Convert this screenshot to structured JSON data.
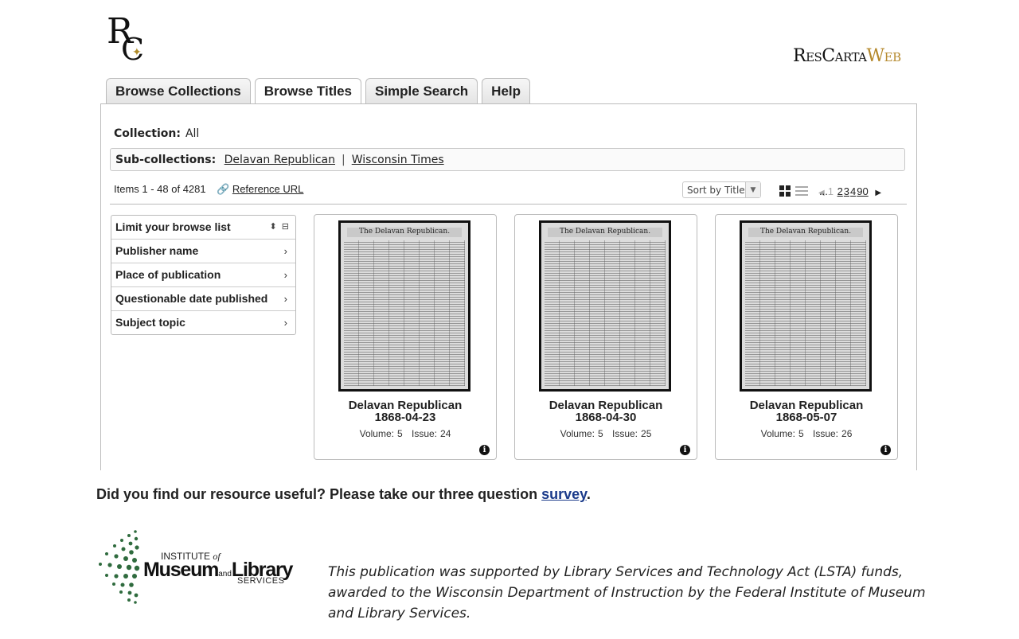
{
  "header": {
    "logo_mark": "RC",
    "brand_part1": "ResCarta",
    "brand_part2": "Web"
  },
  "tabs": [
    {
      "label": "Browse Collections"
    },
    {
      "label": "Browse Titles",
      "active": true
    },
    {
      "label": "Simple Search"
    },
    {
      "label": "Help"
    }
  ],
  "collection": {
    "label": "Collection:",
    "value": "All"
  },
  "subcollections": {
    "label": "Sub-collections:",
    "items": [
      "Delavan Republican",
      "Wisconsin Times"
    ],
    "separator": "|"
  },
  "results": {
    "items_text": "Items 1 - 48 of 4281",
    "reference_url": "Reference URL"
  },
  "sort": {
    "selected": "Sort by Title"
  },
  "pager": {
    "current": "1",
    "pages": [
      "2",
      "3",
      "4"
    ],
    "ellipsis": "...",
    "last": "90"
  },
  "facets": {
    "header": "Limit your browse list",
    "items": [
      "Publisher name",
      "Place of publication",
      "Questionable date published",
      "Subject topic"
    ]
  },
  "cards": [
    {
      "title": "Delavan Republican",
      "date": "1868-04-23",
      "volume_label": "Volume:",
      "volume": "5",
      "issue_label": "Issue:",
      "issue": "24",
      "masthead": "The Delavan Republican."
    },
    {
      "title": "Delavan Republican",
      "date": "1868-04-30",
      "volume_label": "Volume:",
      "volume": "5",
      "issue_label": "Issue:",
      "issue": "25",
      "masthead": "The Delavan Republican."
    },
    {
      "title": "Delavan Republican",
      "date": "1868-05-07",
      "volume_label": "Volume:",
      "volume": "5",
      "issue_label": "Issue:",
      "issue": "26",
      "masthead": "The Delavan Republican."
    }
  ],
  "survey": {
    "text": "Did you find our resource useful? Please take our three question ",
    "link": "survey",
    "end": "."
  },
  "imls": {
    "line1": "INSTITUTE",
    "of": "of",
    "museum": "Museum",
    "and": "and",
    "library": "Library",
    "services": "SERVICES"
  },
  "funding_text": "This publication was supported by Library Services and Technology Act (LSTA) funds, awarded to the Wisconsin Department of Instruction by the Federal Institute of Museum and Library Services.",
  "colors": {
    "accent_gold": "#b5892d",
    "link_blue": "#1a3a8a"
  }
}
